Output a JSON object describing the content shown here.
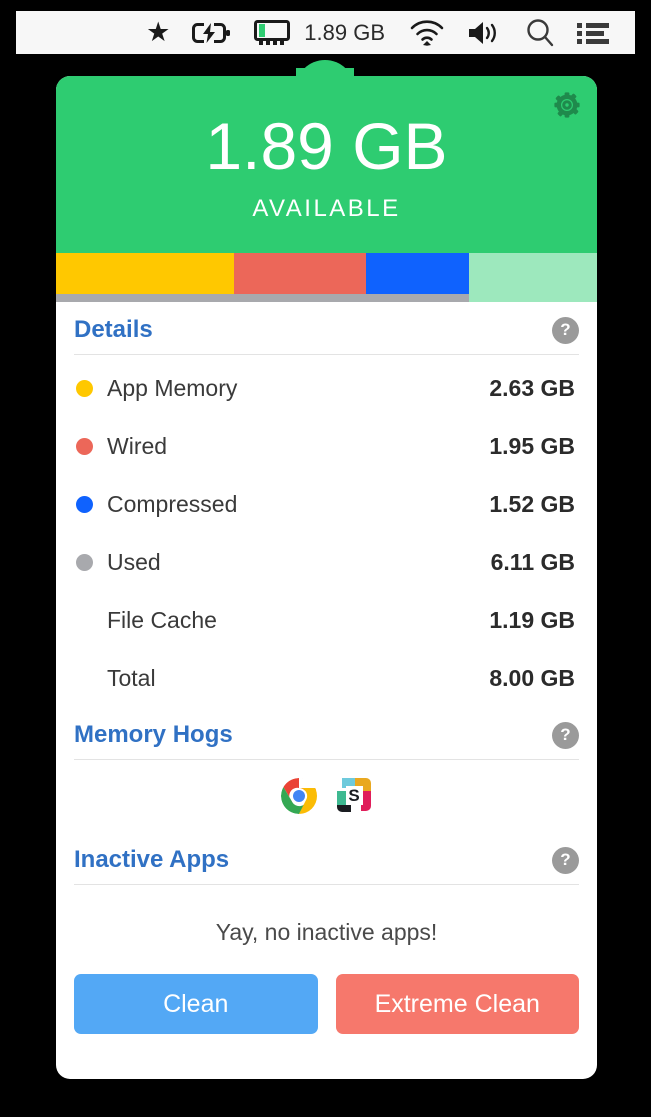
{
  "menubar": {
    "items": [
      {
        "name": "star-icon",
        "label": "★",
        "type": "icon"
      },
      {
        "name": "battery-charging-icon",
        "label": "",
        "type": "icon"
      },
      {
        "name": "memory-chip-icon",
        "label": "",
        "type": "icon"
      },
      {
        "name": "memory-readout",
        "label": "1.89 GB",
        "type": "text"
      },
      {
        "name": "wifi-icon",
        "label": "",
        "type": "icon"
      },
      {
        "name": "volume-icon",
        "label": "",
        "type": "icon"
      },
      {
        "name": "search-icon",
        "label": "",
        "type": "icon"
      },
      {
        "name": "list-menu-icon",
        "label": "",
        "type": "icon"
      }
    ],
    "memory_readout": "1.89 GB"
  },
  "hero": {
    "value": "1.89 GB",
    "label": "AVAILABLE",
    "background_color": "#2ecc71",
    "gear_color": "#1f8a4c"
  },
  "memory_bar": {
    "total_gb": 8.0,
    "segments": [
      {
        "name": "app-memory",
        "color": "#ffc800",
        "gb": 2.63
      },
      {
        "name": "wired",
        "color": "#ec6759",
        "gb": 1.95
      },
      {
        "name": "compressed",
        "color": "#0f62fe",
        "gb": 1.52
      },
      {
        "name": "free",
        "color": "#9de8bd",
        "gb": 1.9
      }
    ],
    "used_track": {
      "name": "used",
      "color": "#a8a9ad",
      "gb": 6.11
    }
  },
  "details": {
    "title": "Details",
    "help_label": "?",
    "rows": [
      {
        "label": "App Memory",
        "value": "2.63 GB",
        "dot": "#ffc800"
      },
      {
        "label": "Wired",
        "value": "1.95 GB",
        "dot": "#ec6759"
      },
      {
        "label": "Compressed",
        "value": "1.52 GB",
        "dot": "#0f62fe"
      },
      {
        "label": "Used",
        "value": "6.11 GB",
        "dot": "#a8a9ad"
      },
      {
        "label": "File Cache",
        "value": "1.19 GB",
        "dot": null
      },
      {
        "label": "Total",
        "value": "8.00 GB",
        "dot": null
      }
    ]
  },
  "memory_hogs": {
    "title": "Memory Hogs",
    "help_label": "?",
    "apps": [
      {
        "name": "chrome-app-icon",
        "label": "Chrome"
      },
      {
        "name": "slack-app-icon",
        "label": "S"
      }
    ]
  },
  "inactive_apps": {
    "title": "Inactive Apps",
    "help_label": "?",
    "empty_message": "Yay, no inactive apps!"
  },
  "actions": {
    "clean_label": "Clean",
    "clean_color": "#53a8f5",
    "extreme_label": "Extreme Clean",
    "extreme_color": "#f6786c"
  }
}
